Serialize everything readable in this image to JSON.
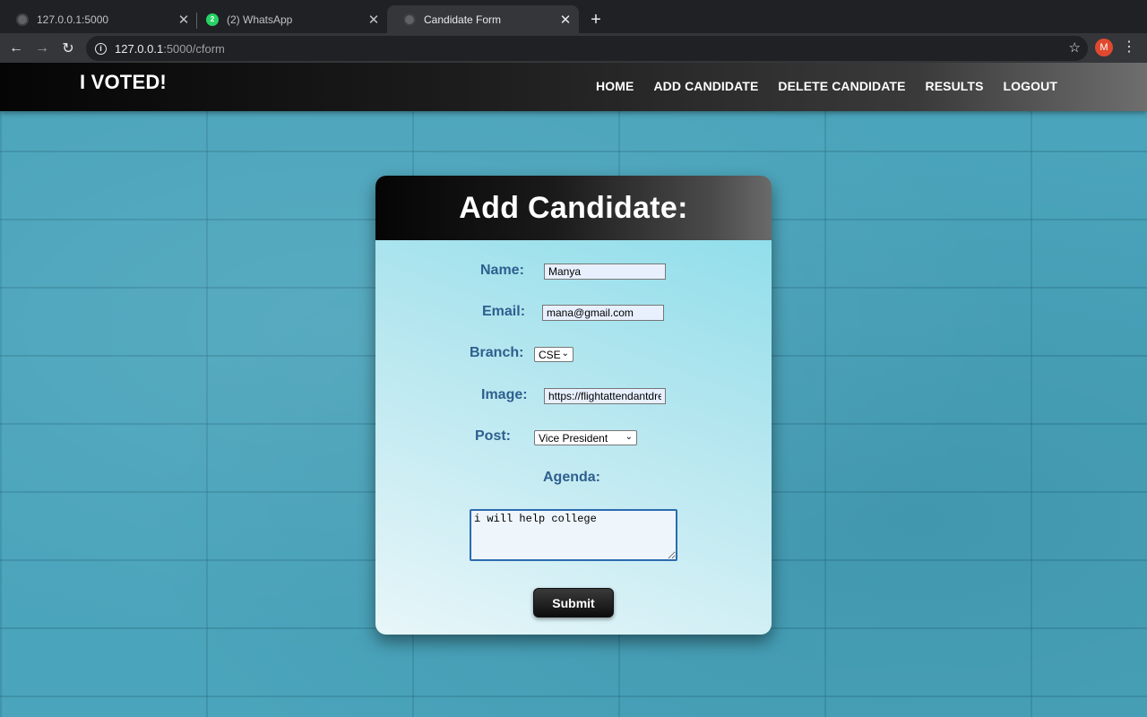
{
  "browser": {
    "tabs": [
      {
        "title": "127.0.0.1:5000",
        "icon": "globe-icon"
      },
      {
        "title": "(2) WhatsApp",
        "icon": "whatsapp-icon",
        "badge": "2"
      },
      {
        "title": "Candidate Form",
        "icon": "globe-icon",
        "active": true
      }
    ],
    "url_host": "127.0.0.1",
    "url_path": ":5000/cform",
    "profile_initial": "M"
  },
  "nav": {
    "brand": "I VOTED!",
    "links": [
      "HOME",
      "ADD CANDIDATE",
      "DELETE CANDIDATE",
      "RESULTS",
      "LOGOUT"
    ]
  },
  "form": {
    "title": "Add Candidate:",
    "name_label": "Name:",
    "name_value": "Manya",
    "email_label": "Email:",
    "email_value": "mana@gmail.com",
    "branch_label": "Branch:",
    "branch_value": "CSE",
    "image_label": "Image:",
    "image_value": "https://flightattendantdreams",
    "post_label": "Post:",
    "post_value": "Vice President",
    "agenda_label": "Agenda:",
    "agenda_value": "i will help college",
    "submit_label": "Submit"
  }
}
